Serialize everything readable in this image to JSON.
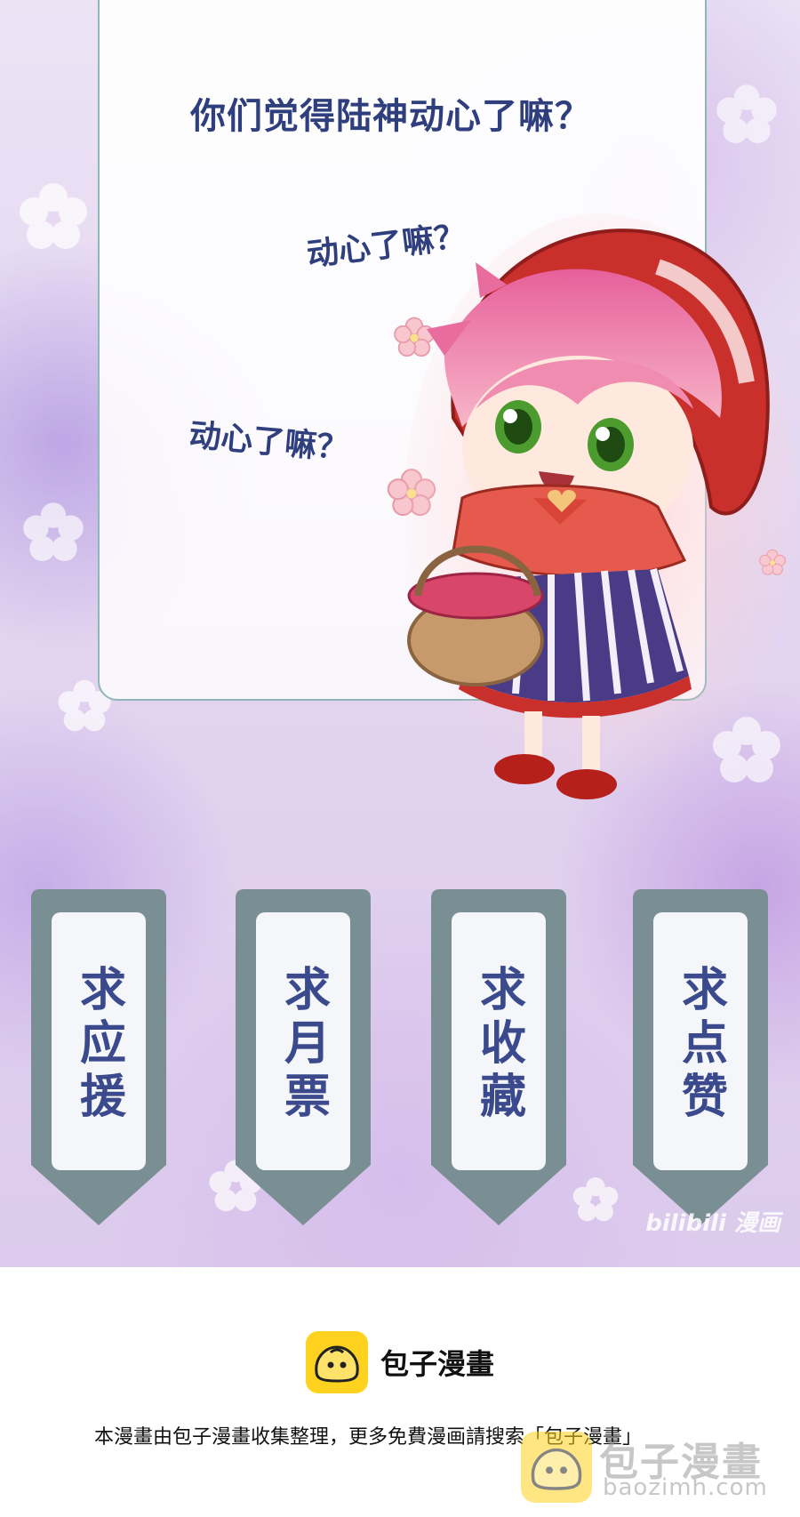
{
  "dialogue": {
    "question": "你们觉得陆神动心了嘛？",
    "echo_1": "动心了嘛？",
    "echo_2": "动心了嘛？"
  },
  "tags": [
    {
      "label": "求应援"
    },
    {
      "label": "求月票"
    },
    {
      "label": "求收藏"
    },
    {
      "label": "求点赞"
    }
  ],
  "watermark": {
    "bilibili": "bilibili 漫画"
  },
  "footer": {
    "brand_name": "包子漫畫",
    "note": "本漫畫由包子漫畫收集整理，更多免費漫画請搜索「包子漫畫」",
    "site_title": "包子漫畫",
    "site_domain": "baozimh.com"
  },
  "colors": {
    "text_navy": "#2f3f7e",
    "tag_frame": "#7a8f93",
    "tag_face": "#f5f6fa",
    "brand_yellow": "#ffd21f"
  },
  "icons": [
    "bun-logo-icon",
    "flower-icon"
  ]
}
